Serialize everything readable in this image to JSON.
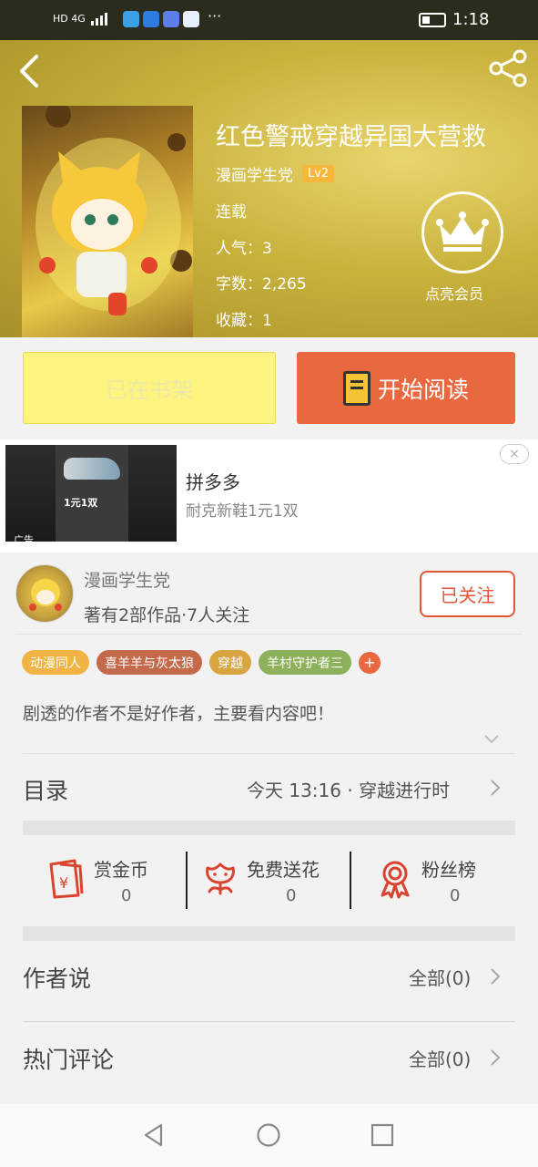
{
  "status_bar": {
    "network": "HD 4G",
    "time": "1:18",
    "more": "···"
  },
  "book": {
    "title": "红色警戒穿越异国大营救",
    "author": "漫画学生党",
    "level": "Lv2",
    "status": "连载",
    "popularity": "人气：3",
    "word_count": "字数：2,265",
    "favorites": "收藏：1"
  },
  "vip": {
    "label": "点亮会员"
  },
  "actions": {
    "shelf_label": "已在书架",
    "read_label": "开始阅读"
  },
  "ad": {
    "brand": "拼多多",
    "description": "耐克新鞋1元1双",
    "tag": "广告",
    "image_price": "1元1双",
    "close": "×"
  },
  "author_card": {
    "name": "漫画学生党",
    "stats": "著有2部作品·7人关注",
    "follow_label": "已关注"
  },
  "tags": [
    {
      "label": "动漫同人",
      "color": "#f1b344"
    },
    {
      "label": "喜羊羊与灰太狼",
      "color": "#c46a4b"
    },
    {
      "label": "穿越",
      "color": "#d8a640"
    },
    {
      "label": "羊村守护者三",
      "color": "#8db05a"
    }
  ],
  "tag_add": "+",
  "blurb": "剧透的作者不是好作者，主要看内容吧！",
  "catalog": {
    "label": "目录",
    "latest": "今天 13:16 · 穿越进行时"
  },
  "stats": [
    {
      "label": "赏金币",
      "value": "0",
      "icon": "red-envelope-icon"
    },
    {
      "label": "免费送花",
      "value": "0",
      "icon": "flower-icon"
    },
    {
      "label": "粉丝榜",
      "value": "0",
      "icon": "medal-icon"
    }
  ],
  "author_says": {
    "label": "作者说",
    "right": "全部(0)"
  },
  "hot_comments": {
    "label": "热门评论",
    "right": "全部(0)"
  },
  "colors": {
    "accent": "#e96840",
    "follow": "#e2573c",
    "shelf": "#fdf37f",
    "icon_red": "#d9442e"
  }
}
